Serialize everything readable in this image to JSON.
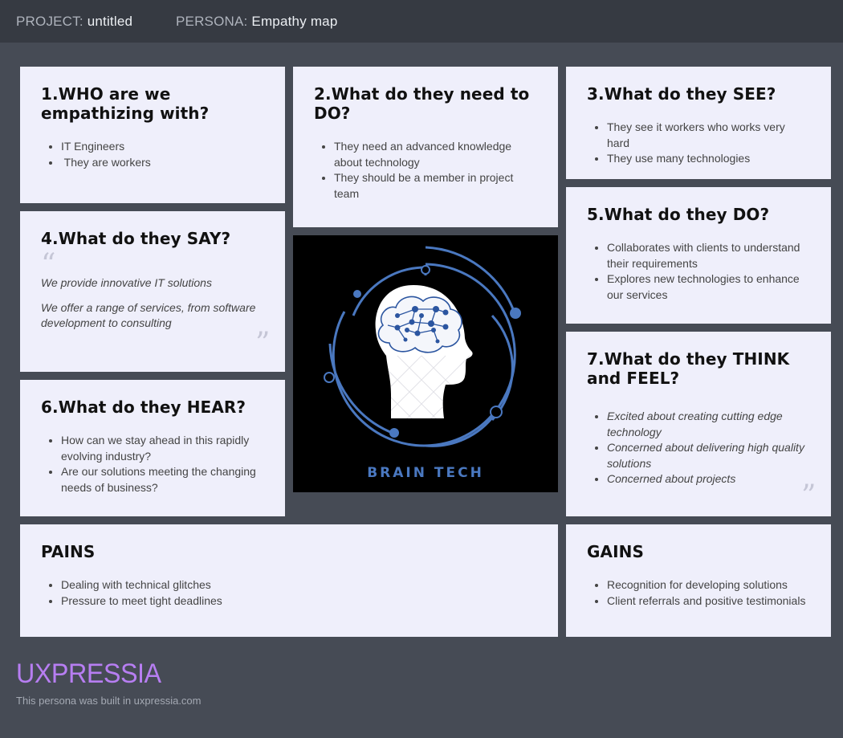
{
  "header": {
    "project_key": "PROJECT:",
    "project_value": "untitled",
    "persona_key": "PERSONA:",
    "persona_value": "Empathy map"
  },
  "cards": {
    "who": {
      "title": "1.WHO are we empathizing with?",
      "items": [
        "IT Engineers",
        " They are workers"
      ]
    },
    "do_need": {
      "title": "2.What do they need to DO?",
      "items": [
        "They need an advanced knowledge about technology",
        "They should be a member in project team"
      ]
    },
    "see": {
      "title": "3.What do they SEE?",
      "items": [
        "They see it workers who works very hard",
        "They use many technologies"
      ]
    },
    "say": {
      "title": "4.What do they SAY?",
      "quotes": [
        "We provide innovative IT solutions",
        "We offer a range of services, from software development to consulting"
      ]
    },
    "do": {
      "title": "5.What do they DO?",
      "items": [
        "Collaborates with clients to understand their requirements",
        "Explores new technologies to enhance our services"
      ]
    },
    "hear": {
      "title": "6.What do they HEAR?",
      "items": [
        "How can we stay ahead in this rapidly evolving industry?",
        "Are our solutions meeting the changing needs of business?"
      ]
    },
    "think_feel": {
      "title": "7.What do they THINK and FEEL?",
      "items": [
        "Excited about creating cutting edge technology",
        "Concerned about delivering high quality solutions",
        "Concerned about projects"
      ]
    },
    "pains": {
      "title": "PAINS",
      "items": [
        "Dealing with technical glitches",
        "Pressure to meet tight deadlines"
      ]
    },
    "gains": {
      "title": "GAINS",
      "items": [
        "Recognition for developing solutions",
        "Client referrals and positive testimonials"
      ]
    }
  },
  "image": {
    "caption": "BRAIN TECH",
    "accent": "#4a78c0"
  },
  "footer": {
    "logo": "UXPRESSIA",
    "note": "This persona was built in uxpressia.com",
    "logo_color": "#b77ef2"
  }
}
